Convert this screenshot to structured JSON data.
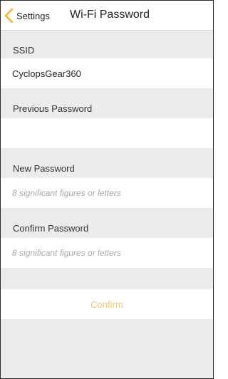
{
  "navbar": {
    "back_label": "Settings",
    "back_icon": "chevron-left-icon",
    "title": "Wi-Fi Password",
    "accent_color": "#f5b12a"
  },
  "ssid": {
    "header": "SSID",
    "value": "CyclopsGear360"
  },
  "previous_password": {
    "header": "Previous Password",
    "value": "",
    "placeholder": ""
  },
  "new_password": {
    "header": "New Password",
    "value": "",
    "placeholder": "8 significant figures or letters"
  },
  "confirm_password": {
    "header": "Confirm Password",
    "value": "",
    "placeholder": "8 significant figures or letters"
  },
  "confirm_button": {
    "label": "Confirm",
    "color": "#f3c76b"
  }
}
